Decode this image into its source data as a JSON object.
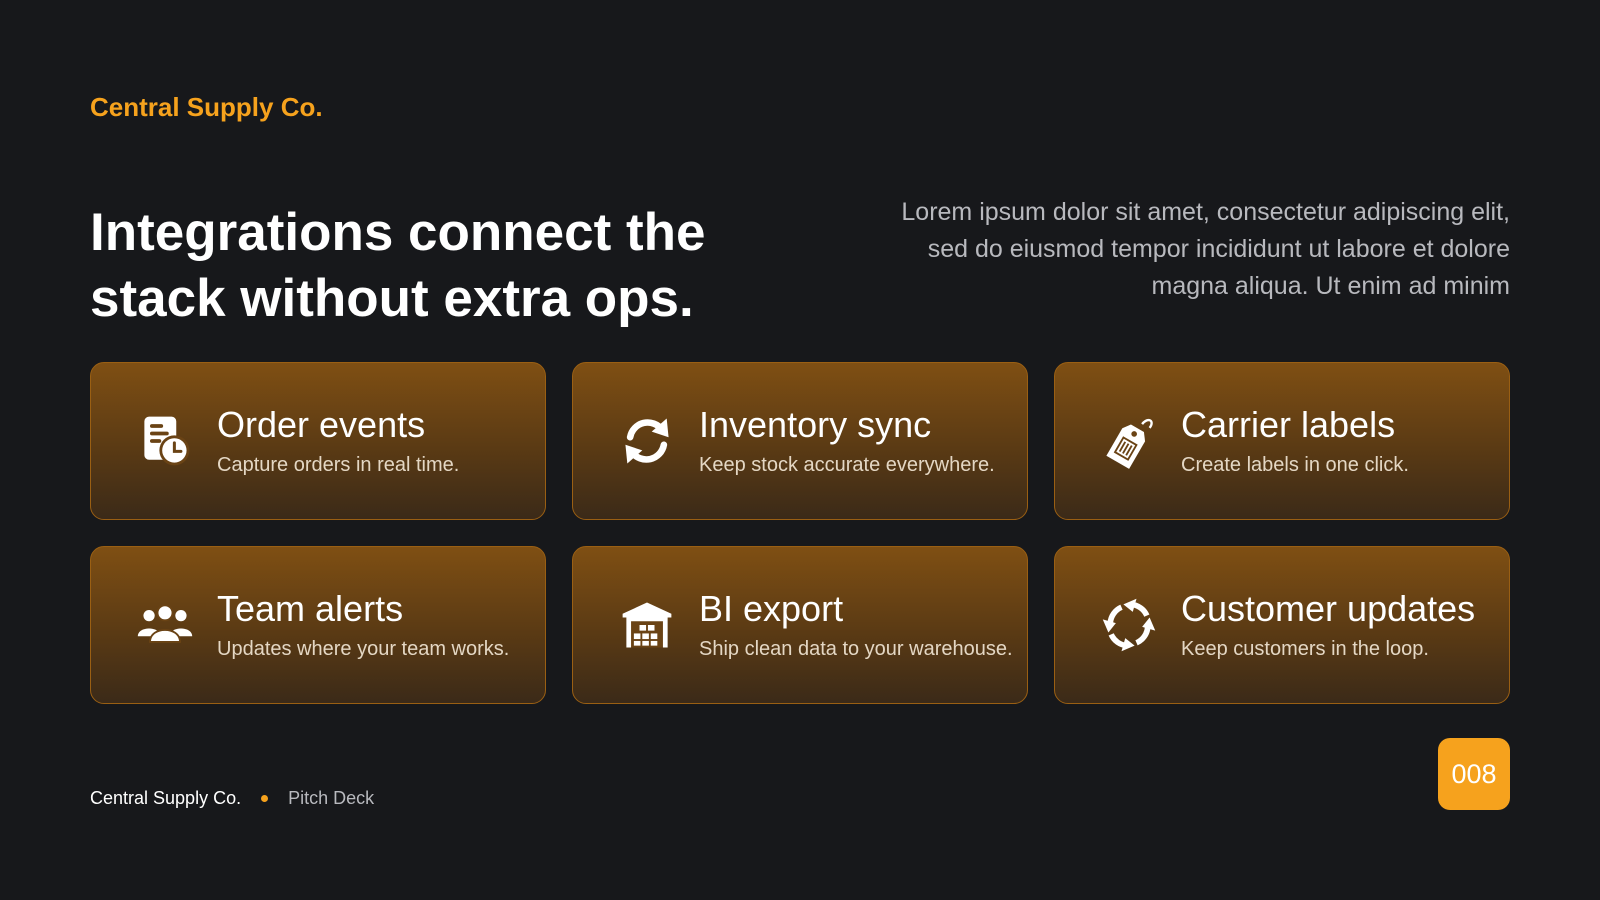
{
  "brand": "Central Supply Co.",
  "headline": "Integrations connect the stack without extra ops.",
  "intro": "Lorem ipsum dolor sit amet, consectetur adipiscing elit, sed do eiusmod tempor incididunt ut labore et dolore magna aliqua. Ut enim ad minim",
  "accent_color": "#f6a21d",
  "cards": [
    {
      "icon": "order-receipt-clock-icon",
      "title": "Order events",
      "desc": "Capture orders in real time."
    },
    {
      "icon": "sync-arrows-icon",
      "title": "Inventory sync",
      "desc": "Keep stock accurate everywhere."
    },
    {
      "icon": "shipping-tag-icon",
      "title": "Carrier labels",
      "desc": "Create labels in one click."
    },
    {
      "icon": "users-group-icon",
      "title": "Team alerts",
      "desc": "Updates where your team works."
    },
    {
      "icon": "warehouse-icon",
      "title": "BI export",
      "desc": "Ship clean data to your warehouse."
    },
    {
      "icon": "refresh-arrows-icon",
      "title": "Customer updates",
      "desc": "Keep customers in the loop."
    }
  ],
  "footer": {
    "company": "Central Supply Co.",
    "doc_type": "Pitch Deck"
  },
  "page_number": "008"
}
